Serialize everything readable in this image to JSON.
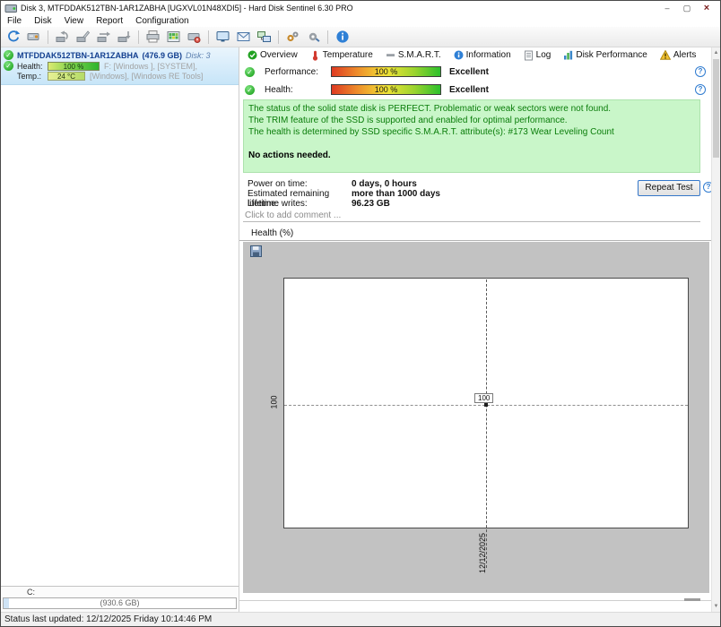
{
  "window": {
    "title": "Disk 3, MTFDDAK512TBN-1AR1ZABHA [UGXVL01N48XDI5]  -  Hard Disk Sentinel 6.30 PRO",
    "minimize": "–",
    "maximize": "▢",
    "close": "×"
  },
  "menubar": {
    "items": [
      "File",
      "Disk",
      "View",
      "Report",
      "Configuration"
    ]
  },
  "toolbar": {
    "buttons": [
      "refresh",
      "detect-disks",
      "surface-test",
      "write-test",
      "seek-test",
      "random-test",
      "print",
      "surface-map",
      "disk-report",
      "remote-monitor",
      "send-mail",
      "network-disks",
      "settings-gears",
      "preferences-gear",
      "information"
    ]
  },
  "sidebar": {
    "disk": {
      "name": "MTFDDAK512TBN-1AR1ZABHA",
      "size": "(476.9 GB)",
      "disk_no": "Disk: 3",
      "health_label": "Health:",
      "health_value": "100 %",
      "temp_label": "Temp.:",
      "temp_value": "24 °C",
      "partitions_line1": "F: [Windows ], [SYSTEM],",
      "partitions_line2": "[Windows], [Windows RE Tools]"
    },
    "drive": {
      "letter": "C:",
      "size": "(930.6 GB)"
    }
  },
  "tabs": [
    {
      "label": "Overview"
    },
    {
      "label": "Temperature"
    },
    {
      "label": "S.M.A.R.T."
    },
    {
      "label": "Information"
    },
    {
      "label": "Log"
    },
    {
      "label": "Disk Performance"
    },
    {
      "label": "Alerts"
    }
  ],
  "overview": {
    "performance_label": "Performance:",
    "performance_value": "100 %",
    "performance_rating": "Excellent",
    "health_label": "Health:",
    "health_value": "100 %",
    "health_rating": "Excellent",
    "status_lines": [
      "The status of the solid state disk is PERFECT. Problematic or weak sectors were not found.",
      "The TRIM feature of the SSD is supported and enabled for optimal performance.",
      "The health is determined by SSD specific S.M.A.R.T. attribute(s):  #173 Wear Leveling Count"
    ],
    "no_actions": "No actions needed.",
    "stats": [
      {
        "label": "Power on time:",
        "value": "0 days, 0 hours"
      },
      {
        "label": "Estimated remaining lifetime:",
        "value": "more than 1000 days"
      },
      {
        "label": "Lifetime writes:",
        "value": "96.23 GB"
      }
    ],
    "repeat_test_label": "Repeat Test",
    "comment_placeholder": "Click to add comment ..."
  },
  "chart": {
    "section_title": "Health (%)",
    "y_tick": "100",
    "point_label": "100",
    "x_tick": "12/12/2025"
  },
  "chart_data": {
    "type": "line",
    "title": "Health (%)",
    "x": [
      "12/12/2025"
    ],
    "series": [
      {
        "name": "Health %",
        "values": [
          100
        ]
      }
    ],
    "annotations": [
      "dashed crosshair at single data point",
      "point label box shows 100"
    ],
    "legend": false
  },
  "statusbar": {
    "text": "Status last updated: 12/12/2025 Friday 10:14:46 PM"
  }
}
